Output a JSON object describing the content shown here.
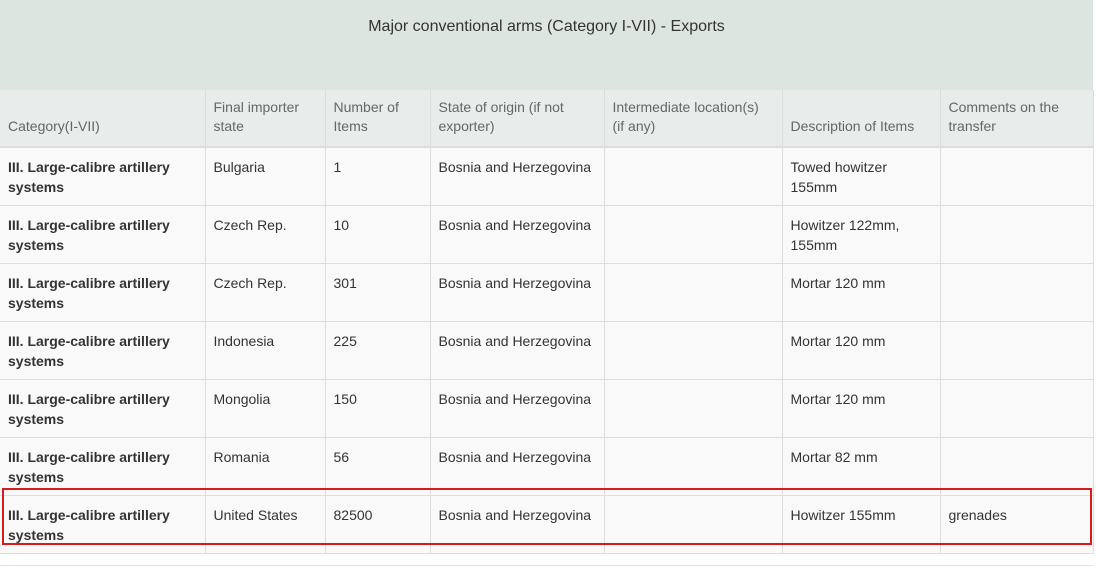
{
  "title": "Major conventional arms (Category I-VII) - Exports",
  "columns": [
    "Category(I-VII)",
    "Final importer state",
    "Number of Items",
    "State of origin (if not exporter)",
    "Intermediate location(s) (if any)",
    "Description of Items",
    "Comments on the transfer"
  ],
  "rows": [
    {
      "category": "III. Large-calibre artillery systems",
      "importer": "Bulgaria",
      "items": "1",
      "origin": "Bosnia and Herzegovina",
      "intermediate": "",
      "description": "Towed howitzer 155mm",
      "comments": ""
    },
    {
      "category": "III. Large-calibre artillery systems",
      "importer": "Czech Rep.",
      "items": "10",
      "origin": "Bosnia and Herzegovina",
      "intermediate": "",
      "description": "Howitzer 122mm, 155mm",
      "comments": ""
    },
    {
      "category": "III. Large-calibre artillery systems",
      "importer": "Czech Rep.",
      "items": "301",
      "origin": "Bosnia and Herzegovina",
      "intermediate": "",
      "description": "Mortar 120 mm",
      "comments": ""
    },
    {
      "category": "III. Large-calibre artillery systems",
      "importer": "Indonesia",
      "items": "225",
      "origin": "Bosnia and Herzegovina",
      "intermediate": "",
      "description": "Mortar 120 mm",
      "comments": ""
    },
    {
      "category": "III. Large-calibre artillery systems",
      "importer": "Mongolia",
      "items": "150",
      "origin": "Bosnia and Herzegovina",
      "intermediate": "",
      "description": "Mortar 120 mm",
      "comments": ""
    },
    {
      "category": "III. Large-calibre artillery systems",
      "importer": "Romania",
      "items": "56",
      "origin": "Bosnia and Herzegovina",
      "intermediate": "",
      "description": "Mortar 82 mm",
      "comments": ""
    },
    {
      "category": "III. Large-calibre artillery systems",
      "importer": "United States",
      "items": "82500",
      "origin": "Bosnia and Herzegovina",
      "intermediate": "",
      "description": "Howitzer 155mm",
      "comments": "grenades"
    }
  ],
  "highlight_color": "#d91a1a"
}
